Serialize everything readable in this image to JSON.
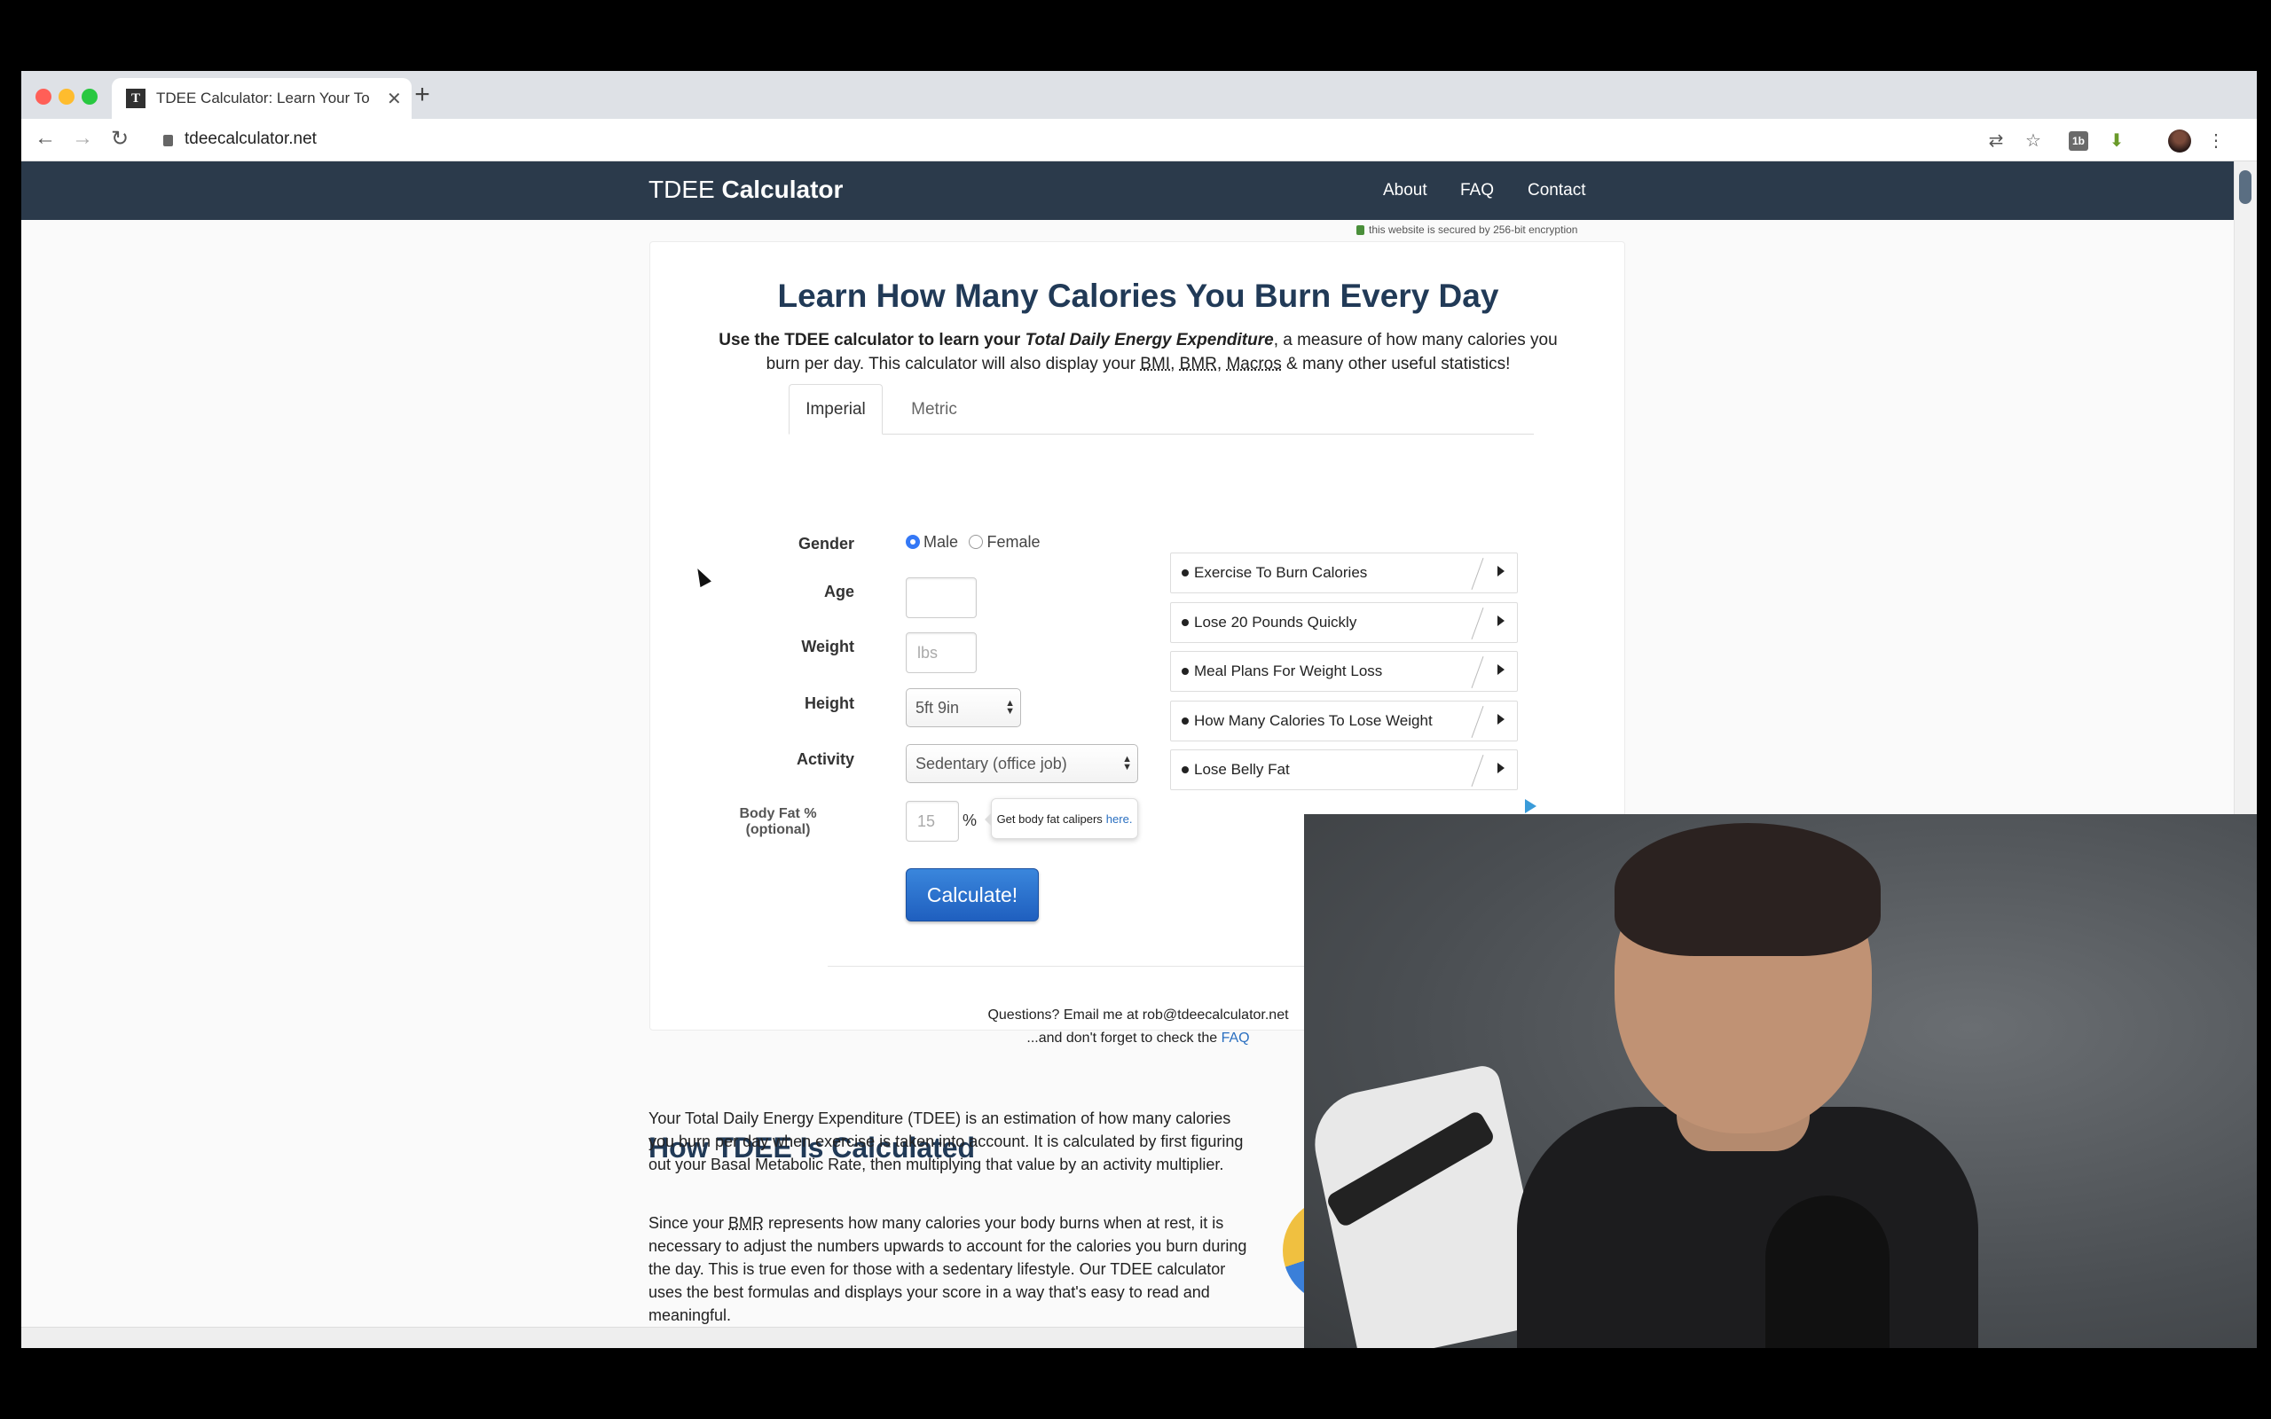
{
  "browser": {
    "tab_title": "TDEE Calculator: Learn Your To",
    "tab_favicon": "T",
    "new_tab": "+",
    "url": "tdeecalculator.net"
  },
  "site": {
    "brand_light": "TDEE",
    "brand_bold": "Calculator",
    "nav": [
      "About",
      "FAQ",
      "Contact"
    ],
    "secure_note": "this website is secured by 256-bit encryption"
  },
  "hero": {
    "title": "Learn How Many Calories You Burn Every Day",
    "desc_bold": "Use the TDEE calculator to learn your ",
    "desc_italic": "Total Daily Energy Expenditure",
    "desc_rest": ", a measure of how many calories you burn per day. This calculator will also display your ",
    "desc_bmi": "BMI",
    "desc_sep1": ", ",
    "desc_bmr": "BMR",
    "desc_sep2": ", ",
    "desc_macros": "Macros",
    "desc_end": " & many other useful statistics!"
  },
  "form": {
    "tabs": [
      "Imperial",
      "Metric"
    ],
    "gender_label": "Gender",
    "gender_options": [
      "Male",
      "Female"
    ],
    "gender_selected": "Male",
    "age_label": "Age",
    "age_value": "",
    "weight_label": "Weight",
    "weight_placeholder": "lbs",
    "height_label": "Height",
    "height_value": "5ft 9in",
    "activity_label": "Activity",
    "activity_value": "Sedentary (office job)",
    "bodyfat_label": "Body Fat %",
    "bodyfat_optional": "(optional)",
    "bodyfat_placeholder": "15",
    "pct_sign": "%",
    "tooltip_text": "Get body fat calipers",
    "tooltip_link": "here.",
    "calculate": "Calculate!"
  },
  "ads": [
    "Exercise To Burn Calories",
    "Lose 20 Pounds Quickly",
    "Meal Plans For Weight Loss",
    "How Many Calories To Lose Weight",
    "Lose Belly Fat"
  ],
  "contact": {
    "line1": "Questions? Email me at rob@tdeecalculator.net",
    "line2_prefix": "...and don't forget to check the ",
    "line2_link": "FAQ"
  },
  "article": {
    "title": "How TDEE Is Calculated",
    "p1": "Your Total Daily Energy Expenditure (TDEE) is an estimation of how many calories you burn per day when exercise is taken into account. It is calculated by first figuring out your Basal Metabolic Rate, then multiplying that value by an activity multiplier.",
    "p2_a": "Since your ",
    "p2_bmr": "BMR",
    "p2_b": " represents how many calories your body burns when at rest, it is necessary to adjust the numbers upwards to account for the calories you burn during the day. This is true even for those with a sedentary lifestyle. Our TDEE calculator uses the best formulas and displays your score in a way that's easy to read and meaningful."
  }
}
